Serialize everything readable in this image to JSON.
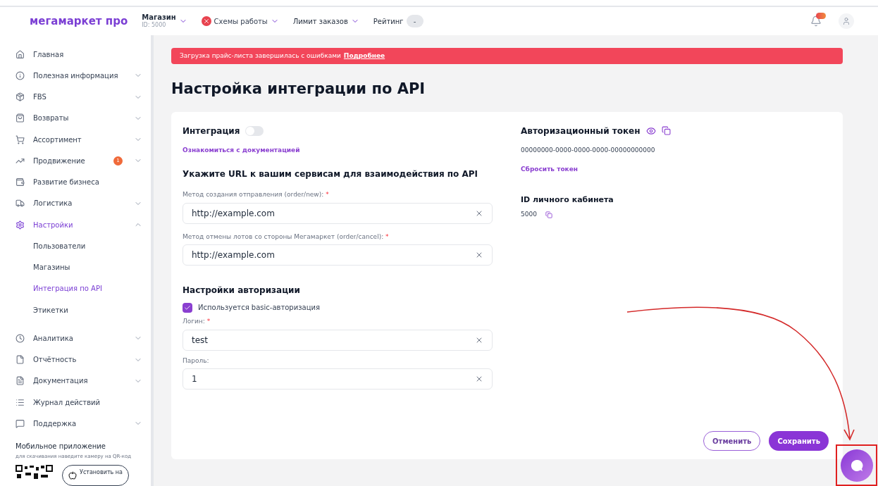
{
  "header": {
    "logo": "мегамаркет про",
    "store": {
      "label": "Магазин",
      "id": "ID: 5000"
    },
    "nav": [
      {
        "label": "Схемы работы",
        "kind": "error"
      },
      {
        "label": "Лимит заказов",
        "kind": "dropdown"
      },
      {
        "label": "Рейтинг",
        "kind": "pill"
      }
    ],
    "rating_value": "-"
  },
  "sidebar": {
    "items": [
      {
        "label": "Главная",
        "selected": false
      },
      {
        "label": "Полезная информация",
        "expandable": true,
        "expanded": false,
        "selected": false
      },
      {
        "label": "FBS",
        "expandable": true,
        "expanded": false,
        "selected": false
      },
      {
        "label": "Возвраты",
        "expandable": true,
        "expanded": false,
        "selected": false
      },
      {
        "label": "Ассортимент",
        "expandable": true,
        "expanded": false,
        "selected": false
      },
      {
        "label": "Продвижение",
        "expandable": true,
        "expanded": false,
        "selected": false,
        "badge": "1"
      },
      {
        "label": "Развитие бизнеса",
        "selected": false
      },
      {
        "label": "Логистика",
        "expandable": true,
        "expanded": false,
        "selected": false
      },
      {
        "label": "Настройки",
        "expandable": true,
        "expanded": true,
        "selected": true,
        "children": [
          {
            "label": "Пользователи",
            "selected": false
          },
          {
            "label": "Магазины",
            "selected": false
          },
          {
            "label": "Интеграция по API",
            "selected": true
          },
          {
            "label": "Этикетки",
            "selected": false
          }
        ]
      },
      {
        "label": "Аналитика",
        "expandable": true,
        "expanded": false,
        "selected": false
      },
      {
        "label": "Отчётность",
        "expandable": true,
        "expanded": false,
        "selected": false
      },
      {
        "label": "Документация",
        "expandable": true,
        "expanded": false,
        "selected": false
      },
      {
        "label": "Журнал действий",
        "selected": false
      },
      {
        "label": "Поддержка",
        "expandable": true,
        "expanded": false,
        "selected": false
      }
    ],
    "mobile_app": {
      "title": "Мобильное приложение",
      "hint": "для скачивания наведите камеру на QR-код",
      "store_button": "Установить на"
    }
  },
  "alert": {
    "text": "Загрузка прайс-листа завершилась с ошибками",
    "link": "Подробнее"
  },
  "title": "Настройка интеграции по API",
  "integration": {
    "label": "Интеграция",
    "on": false,
    "docs_link": "Ознакомиться с документацией"
  },
  "urls_heading": "Укажите URL к вашим сервисам для взаимодействия по API",
  "url_fields": [
    {
      "label": "Метод создания отправления (order/new):",
      "required_mark": "*",
      "value": "http://example.com"
    },
    {
      "label": "Метод отмены лотов со стороны Мегамаркет (order/cancel):",
      "required_mark": "*",
      "value": "http://example.com"
    }
  ],
  "auth": {
    "heading": "Настройки авторизации",
    "basic_label": "Используется basic-авторизация",
    "basic_checked": true,
    "fields": [
      {
        "label": "Логин:",
        "required_mark": "*",
        "value": "test"
      },
      {
        "label": "Пароль:",
        "value": "1"
      }
    ]
  },
  "token": {
    "heading": "Авторизационный токен",
    "value": "00000000-0000-0000-0000-00000000000",
    "reset_link": "Сбросить токен"
  },
  "cabinet": {
    "heading": "ID личного кабинета",
    "value": "5000"
  },
  "buttons": {
    "cancel": "Отменить",
    "save": "Сохранить"
  }
}
